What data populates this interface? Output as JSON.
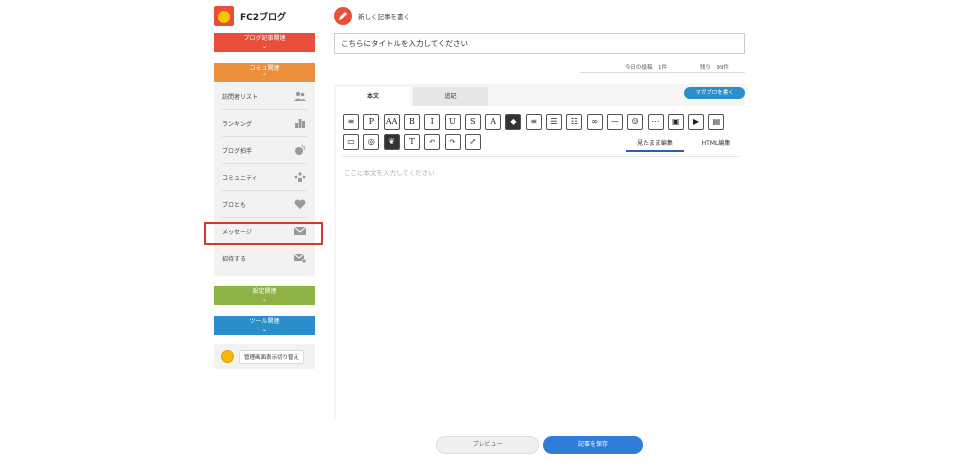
{
  "app": {
    "logo_text": "FC2ブログ"
  },
  "sidebar": {
    "cat_blog": "ブログ記事関連",
    "cat_community": "コミュ関連",
    "cat_settings": "設定関連",
    "cat_tools": "ツール関連",
    "chevron_down": "⌄",
    "chevron_up": "⌃",
    "items": [
      {
        "label": "訪問者リスト",
        "icon": "visitors-icon"
      },
      {
        "label": "ランキング",
        "icon": "ranking-icon"
      },
      {
        "label": "ブログ拍手",
        "icon": "applause-icon"
      },
      {
        "label": "コミュニティ",
        "icon": "community-icon"
      },
      {
        "label": "ブロとも",
        "icon": "blog-friends-icon"
      },
      {
        "label": "メッセージ",
        "icon": "message-icon"
      },
      {
        "label": "招待する",
        "icon": "invite-icon"
      }
    ],
    "switch_label": "管理画面表示切り替え"
  },
  "main": {
    "new_post_label": "新しく記事を書く",
    "title_placeholder": "こちらにタイトルを入力してください",
    "stats_today": "今日の投稿　1件",
    "stats_remaining": "残り　99件",
    "tab_body": "本文",
    "tab_append": "追記",
    "magapro_button": "マガブロを書く",
    "mode_wysiwyg": "見たまま編集",
    "mode_html": "HTML編集",
    "body_placeholder": "ここに本文を入力してください",
    "preview_button": "プレビュー",
    "save_button": "記事を保存"
  },
  "toolbar": [
    {
      "name": "template-button",
      "glyph": "≡"
    },
    {
      "name": "paragraph-button",
      "glyph": "P"
    },
    {
      "name": "font-size-button",
      "glyph": "AA"
    },
    {
      "name": "bold-button",
      "glyph": "B"
    },
    {
      "name": "italic-button",
      "glyph": "I"
    },
    {
      "name": "underline-button",
      "glyph": "U"
    },
    {
      "name": "strikethrough-button",
      "glyph": "S"
    },
    {
      "name": "text-color-button",
      "glyph": "A"
    },
    {
      "name": "background-color-button",
      "glyph": "◆"
    },
    {
      "name": "align-button",
      "glyph": "≡"
    },
    {
      "name": "bullet-list-button",
      "glyph": "☰"
    },
    {
      "name": "numbered-list-button",
      "glyph": "☷"
    },
    {
      "name": "link-button",
      "glyph": "∞"
    },
    {
      "name": "horizontal-rule-button",
      "glyph": "—"
    },
    {
      "name": "emoji-button",
      "glyph": "☺"
    },
    {
      "name": "more-button",
      "glyph": "⋯"
    },
    {
      "name": "image-button",
      "glyph": "▣"
    },
    {
      "name": "youtube-button",
      "glyph": "▶"
    },
    {
      "name": "video-button",
      "glyph": "▤"
    },
    {
      "name": "tv-button",
      "glyph": "▭"
    },
    {
      "name": "instagram-button",
      "glyph": "◎"
    },
    {
      "name": "evernote-button",
      "glyph": "❦"
    },
    {
      "name": "clear-format-button",
      "glyph": "T"
    },
    {
      "name": "undo-button",
      "glyph": "↶"
    },
    {
      "name": "redo-button",
      "glyph": "↷"
    },
    {
      "name": "fullscreen-button",
      "glyph": "⤢"
    }
  ]
}
